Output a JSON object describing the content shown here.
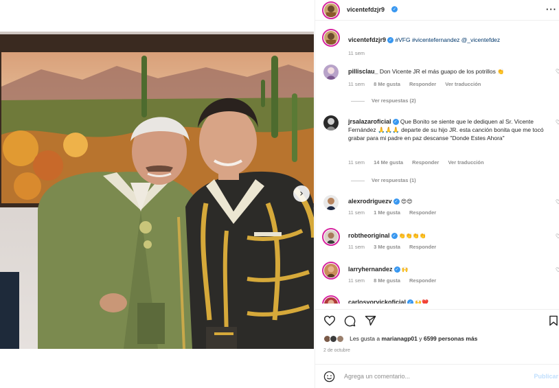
{
  "post": {
    "username": "vicentefdzjr9",
    "carousel_next_icon": "›"
  },
  "caption": {
    "username": "vicentefdzjr9",
    "text": "#VFG #vicentefernandez @_vicentefdez",
    "time": "11 sem"
  },
  "comments": [
    {
      "username": "pillisclau_",
      "verified": false,
      "text": "Don Vicente JR el más guapo de los potrillos",
      "emoji": "👏",
      "time": "11 sem",
      "likes": "8 Me gusta",
      "reply": "Responder",
      "translate": "Ver traducción",
      "view_replies": "Ver respuestas (2)"
    },
    {
      "username": "jrsalazaroficial",
      "verified": true,
      "text": "Que Bonito se siente que le dediquen al Sr. Vicente Fernández 🙏🙏🙏 departe de su hijo JR. esta canción bonita que me tocó grabar para mi padre en paz descanse \"Donde Estes Ahora\"",
      "time": "11 sem",
      "likes": "14 Me gusta",
      "reply": "Responder",
      "translate": "Ver traducción",
      "view_replies": "Ver respuestas (1)"
    },
    {
      "username": "alexrodriguezv",
      "verified": true,
      "text": "😍😍",
      "time": "11 sem",
      "likes": "1 Me gusta",
      "reply": "Responder"
    },
    {
      "username": "robtheoriginal",
      "verified": true,
      "text": "👏👏👏👏",
      "time": "11 sem",
      "likes": "3 Me gusta",
      "reply": "Responder"
    },
    {
      "username": "larryhernandez",
      "verified": true,
      "text": "🙌",
      "time": "11 sem",
      "likes": "8 Me gusta",
      "reply": "Responder"
    },
    {
      "username": "carlosvorvickoficial",
      "verified": true,
      "text": "🙌❤️"
    }
  ],
  "likes_line": {
    "prefix": "Les gusta a ",
    "user": "marianagp01",
    "middle": " y ",
    "count": "6599 personas más"
  },
  "date": "2 de octubre",
  "add_comment": {
    "placeholder": "Agrega un comentario...",
    "publish": "Publicar"
  },
  "icons": {
    "like": "heart-icon",
    "comment": "comment-icon",
    "share": "send-icon",
    "save": "bookmark-icon",
    "emoji": "emoji-icon",
    "more": "more-options-icon"
  },
  "colors": {
    "verified": "#3897f0",
    "story_ring": "#d6249f",
    "muted": "#8e8e8e",
    "publish": "#c0dffd"
  }
}
